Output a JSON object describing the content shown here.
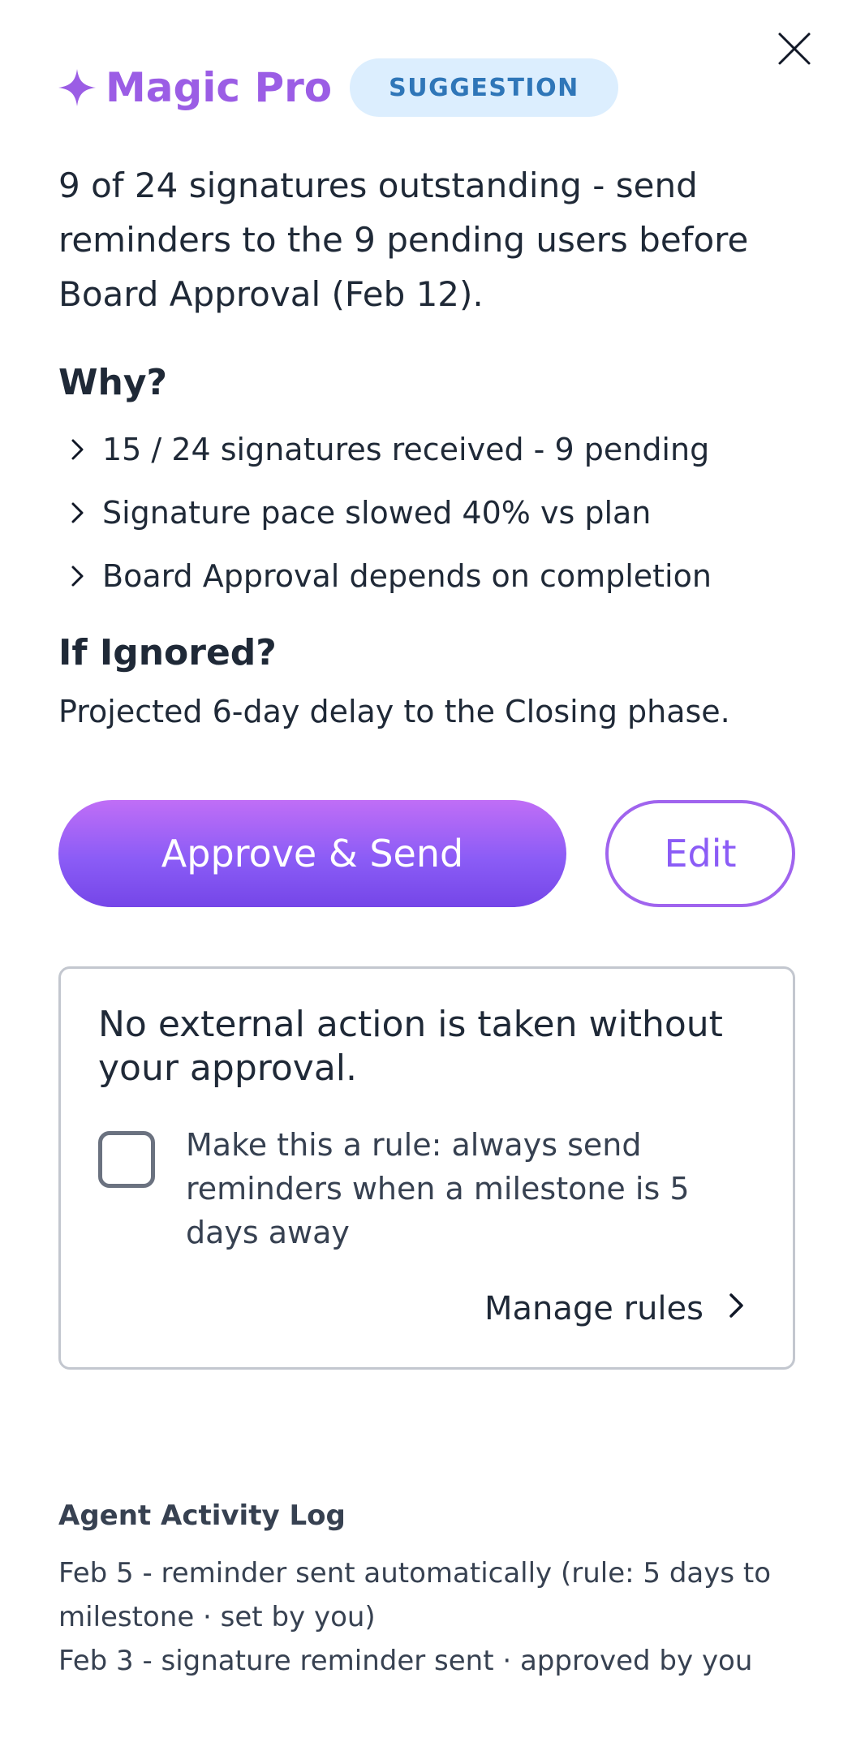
{
  "header": {
    "brand_name": "Magic Pro",
    "badge": "SUGGESTION",
    "brand_color": "#9b5de5"
  },
  "headline": "9 of 24 signatures outstanding - send reminders to the 9 pending users before Board Approval (Feb 12).",
  "why": {
    "title": "Why?",
    "items": [
      {
        "label": "15 / 24 signatures received - 9 pending"
      },
      {
        "label": "Signature pace slowed 40% vs plan"
      },
      {
        "label": "Board Approval depends on completion"
      }
    ]
  },
  "ignored": {
    "title": "If Ignored?",
    "text": "Projected 6-day delay to the Closing phase."
  },
  "actions": {
    "approve_label": "Approve & Send",
    "edit_label": "Edit"
  },
  "notice": {
    "title": "No external action is taken without your approval.",
    "rule_text": "Make this a rule: always send reminders when a milestone is 5 days away",
    "rule_checked": false,
    "manage_label": "Manage rules"
  },
  "activity_log": {
    "title": "Agent Activity Log",
    "entries": [
      {
        "text": "Feb 5 - reminder sent automatically (rule: 5 days to milestone · set by you)"
      },
      {
        "text": "Feb 3 - signature reminder sent · approved by you"
      }
    ]
  },
  "icons": {
    "close": "close-icon",
    "brand": "sparkle-icon",
    "bullet": "chevron-right-icon",
    "manage": "chevron-right-icon"
  }
}
